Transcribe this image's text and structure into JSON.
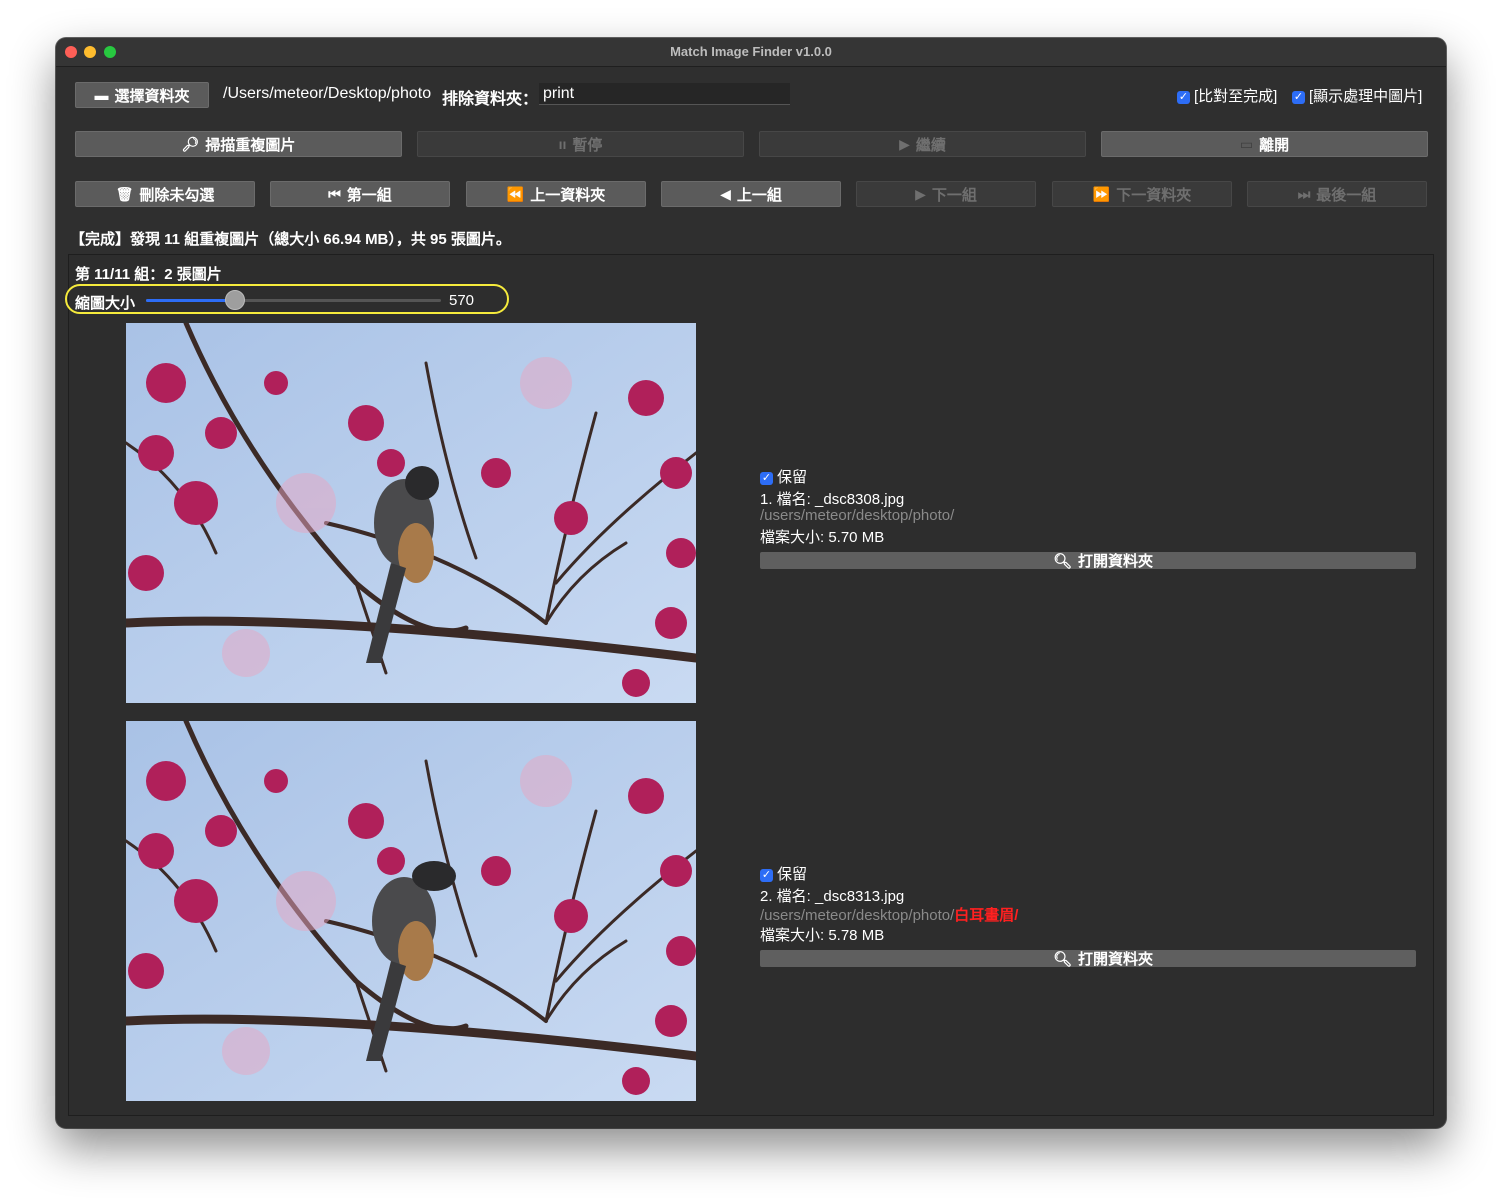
{
  "window": {
    "title": "Match Image Finder v1.0.0"
  },
  "toolbar": {
    "choose_folder": "選擇資料夾",
    "folder_path": "/Users/meteor/Desktop/photo",
    "exclude_label": "排除資料夾：",
    "exclude_value": "print",
    "opt_compare_done": "[比對至完成]",
    "opt_show_processing": "[顯示處理中圖片]"
  },
  "actions": {
    "scan": "掃描重複圖片",
    "pause": "暫停",
    "resume": "繼續",
    "quit": "離開"
  },
  "nav": {
    "delete_unchecked": "刪除未勾選",
    "first_group": "第一組",
    "prev_folder": "上一資料夾",
    "prev_group": "上一組",
    "next_group": "下一組",
    "next_folder": "下一資料夾",
    "last_group": "最後一組"
  },
  "status": {
    "text": "【完成】發現 11 組重複圖片（總大小 66.94 MB），共 95 張圖片。"
  },
  "group": {
    "header": "第 11/11 組：2 張圖片",
    "thumb_label": "縮圖大小",
    "thumb_value": "570",
    "thumb_fraction": 0.3,
    "items": [
      {
        "keep_label": "保留",
        "name_line": "1. 檔名: _dsc8308.jpg",
        "path_gray": "/users/meteor/desktop/photo/",
        "path_red": "",
        "size_line": "檔案大小: 5.70 MB",
        "open_folder": "打開資料夾"
      },
      {
        "keep_label": "保留",
        "name_line": "2. 檔名: _dsc8313.jpg",
        "path_gray": "/users/meteor/desktop/photo/",
        "path_red": "白耳畫眉/",
        "size_line": "檔案大小: 5.78 MB",
        "open_folder": "打開資料夾"
      }
    ]
  },
  "colors": {
    "accent": "#2d6df6",
    "highlight_ring": "#f5ea3c",
    "warning_text": "#ff2020"
  }
}
